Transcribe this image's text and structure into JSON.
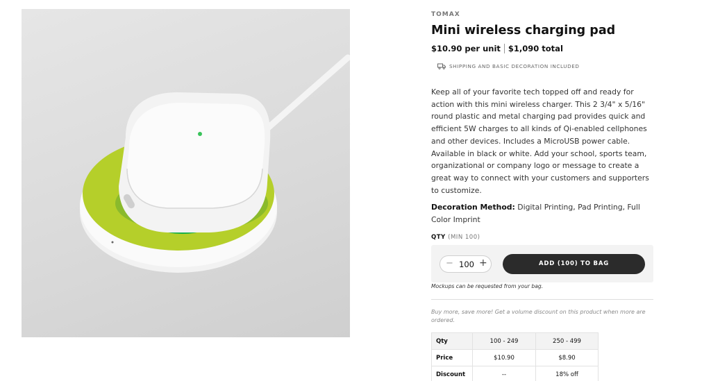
{
  "product": {
    "brand": "TOMAX",
    "title": "Mini wireless charging pad",
    "unit_price": "$10.90 per unit",
    "total_price": "$1,090 total",
    "shipping_note": "SHIPPING AND BASIC DECORATION INCLUDED",
    "description": "Keep all of your favorite tech topped off and ready for action with this mini wireless charger. This 2 3/4\" x 5/16\" round plastic and metal charging pad provides quick and efficient 5W charges to all kinds of Qi-enabled cellphones and other devices. Includes a MicroUSB power cable. Available in black or white. Add your school, sports team, organizational or company logo or message to create a great way to connect with your customers and supporters to customize.",
    "decoration_label": "Decoration Method:",
    "decoration_value": "Digital Printing, Pad Printing, Full Color Imprint",
    "image_icon": "wireless-charger-product-photo",
    "colors": {
      "pad_yellow_green": "#b5cf2a",
      "pad_green": "#15b04a",
      "button_dark": "#2b2b2b"
    }
  },
  "cart": {
    "qty_label": "QTY",
    "qty_min": "(MIN 100)",
    "minus_symbol": "−",
    "plus_symbol": "+",
    "quantity": "100",
    "add_button": "ADD (100) TO BAG",
    "mockup_note": "Mockups can be requested from your bag."
  },
  "volume": {
    "note": "Buy more, save more! Get a volume discount on this product when more are ordered.",
    "table": {
      "header": [
        "Qty",
        "100 - 249",
        "250 - 499"
      ],
      "rows": [
        [
          "Price",
          "$10.90",
          "$8.90"
        ],
        [
          "Discount",
          "--",
          "18% off"
        ]
      ]
    }
  },
  "icons": {
    "shipping": "truck-icon"
  }
}
